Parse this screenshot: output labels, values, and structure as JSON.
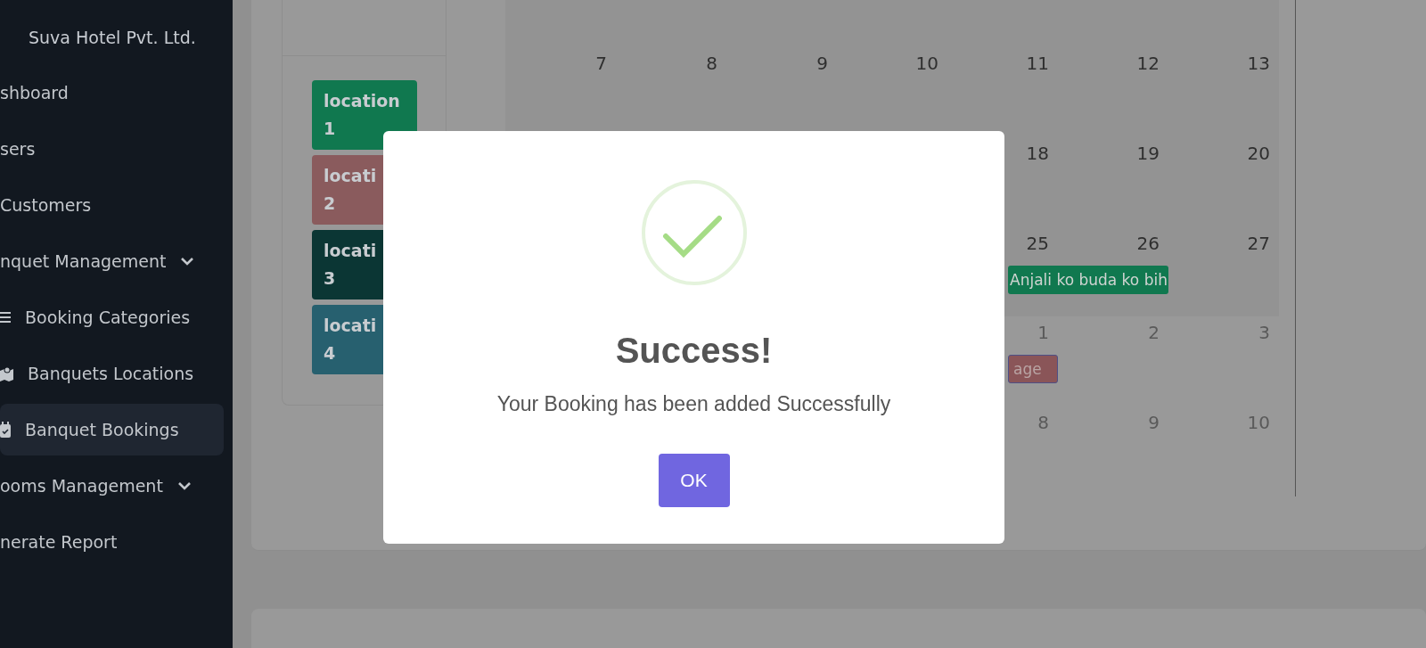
{
  "sidebar": {
    "brand": "Suva Hotel Pvt. Ltd.",
    "items": [
      {
        "kind": "item",
        "label": "shboard",
        "selected": false
      },
      {
        "kind": "item",
        "label": "sers",
        "selected": false
      },
      {
        "kind": "item",
        "label": "Customers",
        "selected": false
      },
      {
        "kind": "group",
        "label": "nquet Management",
        "selected": false
      },
      {
        "kind": "list",
        "label": "Booking Categories",
        "selected": false
      },
      {
        "kind": "map",
        "label": "Banquets Locations",
        "selected": false
      },
      {
        "kind": "calendar",
        "label": "Banquet Bookings",
        "selected": true
      },
      {
        "kind": "group",
        "label": "ooms Management",
        "selected": false
      },
      {
        "kind": "item",
        "label": "nerate Report",
        "selected": false
      }
    ]
  },
  "colors_panel": {
    "chips": [
      {
        "label": "location",
        "number": "1",
        "color": "#10784f"
      },
      {
        "label": "locati",
        "number": "2",
        "color": "#8a5b5d"
      },
      {
        "label": "locati",
        "number": "3",
        "color": "#0b3634"
      },
      {
        "label": "locati",
        "number": "4",
        "color": "#27606f"
      }
    ]
  },
  "calendar": {
    "weeks": [
      {
        "days": [
          {
            "label": "7",
            "other_month": false
          },
          {
            "label": "8",
            "other_month": false
          },
          {
            "label": "9",
            "other_month": false
          },
          {
            "label": "10",
            "other_month": false
          },
          {
            "label": "11",
            "other_month": false
          },
          {
            "label": "12",
            "other_month": false
          },
          {
            "label": "13",
            "other_month": false
          }
        ]
      },
      {
        "days": [
          {
            "label": "18",
            "other_month": false
          },
          {
            "label": "19",
            "other_month": false
          },
          {
            "label": "20",
            "other_month": false
          }
        ]
      },
      {
        "days": [
          {
            "label": "25",
            "other_month": false
          },
          {
            "label": "26",
            "other_month": false
          },
          {
            "label": "27",
            "other_month": false
          }
        ],
        "event": {
          "title": "Anjali ko buda ko bih",
          "color": "#10784f"
        }
      },
      {
        "days": [
          {
            "label": "1",
            "other_month": true
          },
          {
            "label": "2",
            "other_month": true
          },
          {
            "label": "3",
            "other_month": true
          }
        ],
        "event": {
          "title": "age",
          "color": "#8a5558"
        }
      },
      {
        "days": [
          {
            "label": "8",
            "other_month": true
          },
          {
            "label": "9",
            "other_month": true
          },
          {
            "label": "10",
            "other_month": true
          }
        ]
      }
    ]
  },
  "dialog": {
    "title": "Success!",
    "message": "Your Booking has been added Successfully",
    "button": "OK"
  }
}
